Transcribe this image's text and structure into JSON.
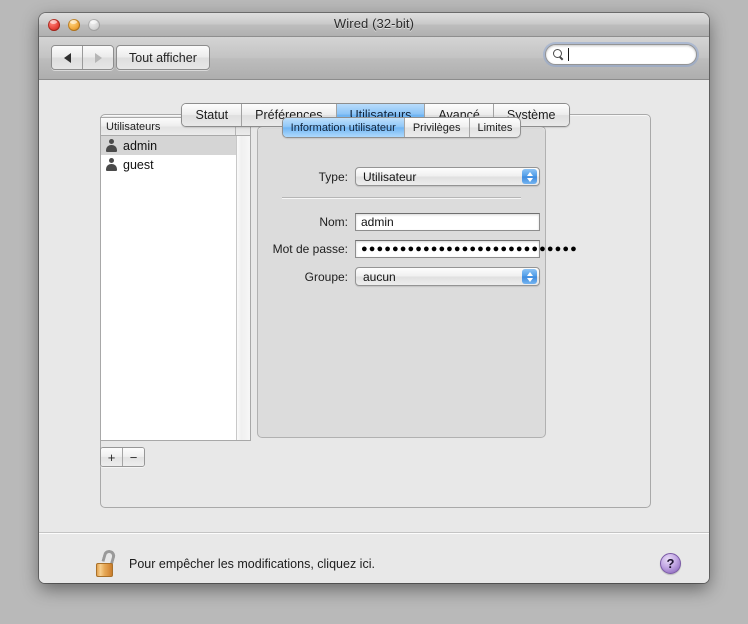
{
  "window": {
    "title": "Wired (32-bit)",
    "traffic_lights": [
      "close-button",
      "minimize-button",
      "zoom-button"
    ]
  },
  "toolbar": {
    "back_label": "back-arrow",
    "forward_label": "forward-arrow",
    "show_all_label": "Tout afficher",
    "search": {
      "value": "",
      "placeholder": "",
      "icon": "search-icon"
    }
  },
  "tabs": [
    {
      "label": "Statut",
      "selected": false
    },
    {
      "label": "Préférences",
      "selected": false
    },
    {
      "label": "Utilisateurs",
      "selected": true
    },
    {
      "label": "Avancé",
      "selected": false
    },
    {
      "label": "Système",
      "selected": false
    }
  ],
  "user_list": {
    "header": "Utilisateurs",
    "rows": [
      {
        "name": "admin",
        "icon": "person-icon",
        "selected": true
      },
      {
        "name": "guest",
        "icon": "person-icon",
        "selected": false
      }
    ],
    "add_button": "+",
    "remove_button": "−"
  },
  "inner_tabs": [
    {
      "label": "Information utilisateur",
      "selected": true
    },
    {
      "label": "Privilèges",
      "selected": false
    },
    {
      "label": "Limites",
      "selected": false
    }
  ],
  "form": {
    "type": {
      "label": "Type:",
      "value": "Utilisateur"
    },
    "name": {
      "label": "Nom:",
      "value": "admin"
    },
    "password": {
      "label": "Mot de passe:",
      "value": "●●●●●●●●●●●●●●●●●●●●●●●●●●●●"
    },
    "group": {
      "label": "Groupe:",
      "value": "aucun"
    }
  },
  "footer": {
    "lock_icon": "padlock-open-icon",
    "lock_text": "Pour empêcher les modifications, cliquez ici.",
    "help_label": "?"
  },
  "colors": {
    "accent_blue": "#6cb2f2",
    "window_bg": "#e8e8e8",
    "panel_bg": "#dcdcdc",
    "lock_gold": "#e6a957",
    "help_purple": "#9d7cc9"
  }
}
